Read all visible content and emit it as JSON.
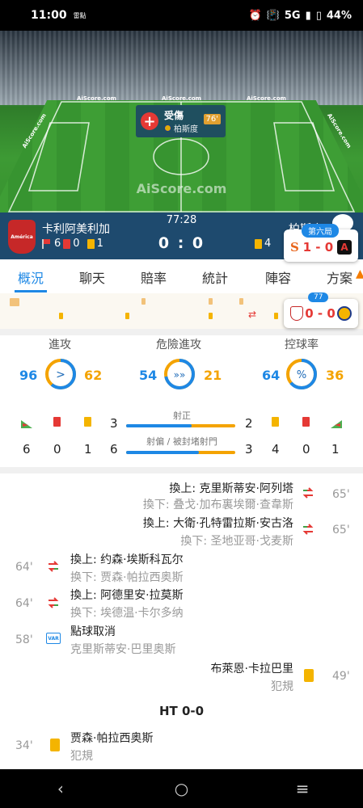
{
  "status_bar": {
    "time": "11:00",
    "app_indicator": "雷點",
    "network": "5G",
    "battery": "44%"
  },
  "pitch": {
    "brand_center": "AiScore.com",
    "board_left": "AiScore.com",
    "board_center": "AiScore.com",
    "board_right": "AiScore.com",
    "board_side_left": "AiScore.com",
    "board_side_right": "AiScore.com",
    "event_title": "受傷",
    "event_player": "柏斯度",
    "event_minute": "76'"
  },
  "match": {
    "clock": "77:28",
    "score": "0 : 0",
    "home": {
      "name": "卡利阿美利加",
      "logo_text": "América",
      "corners": "6",
      "red": "0",
      "yellow": "1"
    },
    "away": {
      "name": "柏斯度",
      "yellow": "4"
    }
  },
  "floating_baseball": {
    "inning": "第六局",
    "score": "1 - 0"
  },
  "floating_soccer": {
    "minute": "77",
    "score": "0 - 0"
  },
  "tabs": [
    "概況",
    "聊天",
    "賠率",
    "統計",
    "陣容",
    "方案"
  ],
  "stats": {
    "attack": {
      "label": "進攻",
      "home": "96",
      "away": "62",
      "home_frac": 0.61
    },
    "danger": {
      "label": "危險進攻",
      "home": "54",
      "away": "21",
      "home_frac": 0.72
    },
    "possession": {
      "label": "控球率",
      "home": "64",
      "away": "36",
      "home_frac": 0.64
    },
    "shots_on": {
      "label": "射正",
      "home": "3",
      "away": "2"
    },
    "shots_off": {
      "label": "射偏 / 被封堵射門",
      "home": "6",
      "away": "3"
    },
    "home_counts": {
      "corners": "6",
      "red": "0",
      "yellow": "1"
    },
    "away_counts": {
      "yellow": "4",
      "red": "0",
      "corners": "1"
    }
  },
  "events": [
    {
      "in": "換上: 克里斯蒂安·阿列塔",
      "out": "換下: 叠戈·加布裏埃爾·查韋斯",
      "minute": "65'"
    },
    {
      "in": "換上: 大衛·孔特雷拉斯·安古洛",
      "out": "換下: 圣地亚哥·戈麦斯",
      "minute": "65'"
    },
    {
      "in": "換上: 约森·埃斯科瓦尔",
      "out": "换下: 贾森·帕拉西奥斯",
      "minute": "64'"
    },
    {
      "in": "換上: 阿德里安·拉莫斯",
      "out": "换下: 埃德温·卡尔多纳",
      "minute": "64'"
    },
    {
      "title": "點球取消",
      "player": "克里斯蒂安·巴里奥斯",
      "minute": "58'",
      "tag": "VAR"
    },
    {
      "player": "布萊恩·卡拉巴里",
      "note": "犯規",
      "minute": "49'"
    },
    {
      "player": "贾森·帕拉西奥斯",
      "note": "犯規",
      "minute": "34'"
    }
  ],
  "halftime": "HT 0-0",
  "colors": {
    "accent": "#1e88e5",
    "home": "#1e88e5",
    "away": "#f4a300",
    "header": "#1e4a6e"
  }
}
